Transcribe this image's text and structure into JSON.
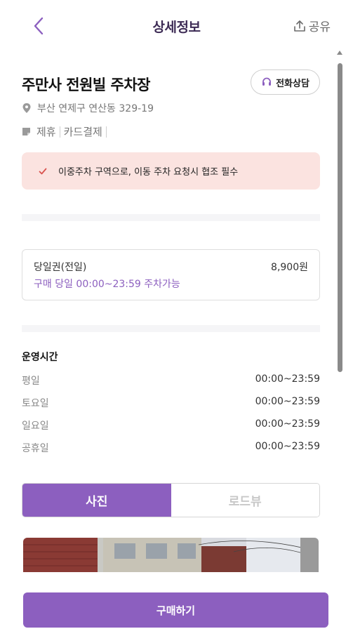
{
  "header": {
    "title": "상세정보",
    "share_label": "공유"
  },
  "lot": {
    "name": "주만사 전원빌 주차장",
    "call_label": "전화상담",
    "address": "부산 연제구 연산동 329-19",
    "tags": [
      "제휴",
      "카드결제"
    ]
  },
  "notice": {
    "text": "이중주차 구역으로, 이동 주차 요청시 협조 필수"
  },
  "ticket": {
    "name": "당일권(전일)",
    "price": "8,900원",
    "desc": "구매 당일 00:00~23:59 주차가능"
  },
  "hours": {
    "title": "운영시간",
    "rows": [
      {
        "day": "평일",
        "time": "00:00~23:59"
      },
      {
        "day": "토요일",
        "time": "00:00~23:59"
      },
      {
        "day": "일요일",
        "time": "00:00~23:59"
      },
      {
        "day": "공휴일",
        "time": "00:00~23:59"
      }
    ]
  },
  "photo_tabs": {
    "photo_label": "사진",
    "roadview_label": "로드뷰",
    "active": "photo"
  },
  "footer": {
    "buy_label": "구매하기"
  },
  "colors": {
    "accent": "#8c5fbf",
    "notice_bg": "#fbe3e0",
    "notice_check": "#d9534f"
  }
}
